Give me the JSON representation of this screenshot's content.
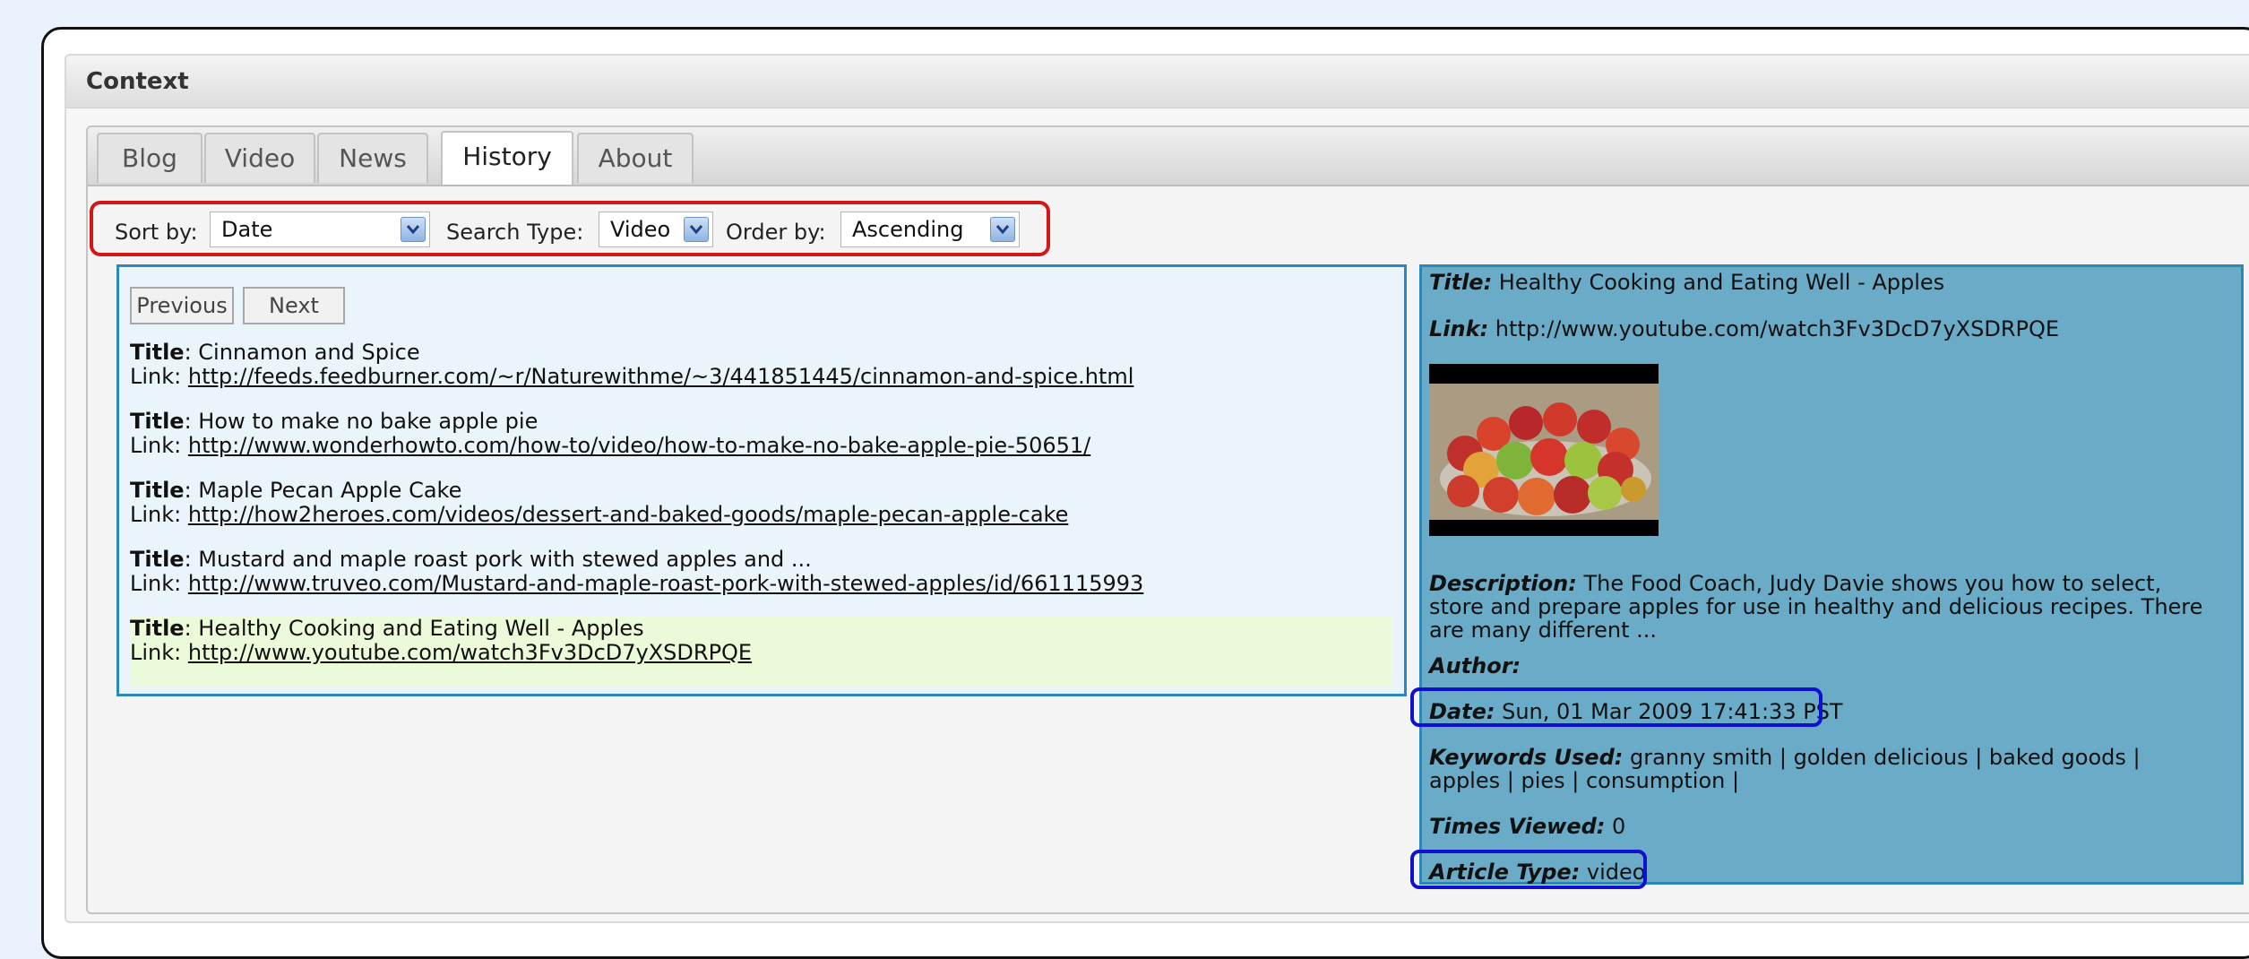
{
  "context": {
    "title": "Context"
  },
  "tabs": [
    {
      "label": "Blog"
    },
    {
      "label": "Video"
    },
    {
      "label": "News"
    },
    {
      "label": "History"
    },
    {
      "label": "About"
    }
  ],
  "controls": {
    "sort_by_label": "Sort by:",
    "sort_by_value": "Date",
    "search_type_label": "Search Type:",
    "search_type_value": "Video",
    "order_by_label": "Order by:",
    "order_by_value": "Ascending"
  },
  "pager": {
    "previous": "Previous",
    "next": "Next"
  },
  "results": [
    {
      "title_label": "Title",
      "title": ": Cinnamon and Spice",
      "link_label": "Link: ",
      "link": "http://feeds.feedburner.com/~r/Naturewithme/~3/441851445/cinnamon-and-spice.html"
    },
    {
      "title_label": "Title",
      "title": ": How to make no bake apple pie",
      "link_label": "Link: ",
      "link": "http://www.wonderhowto.com/how-to/video/how-to-make-no-bake-apple-pie-50651/"
    },
    {
      "title_label": "Title",
      "title": ": Maple Pecan Apple Cake",
      "link_label": "Link: ",
      "link": "http://how2heroes.com/videos/dessert-and-baked-goods/maple-pecan-apple-cake"
    },
    {
      "title_label": "Title",
      "title": ": Mustard and maple roast pork with stewed apples and ...",
      "link_label": "Link: ",
      "link": "http://www.truveo.com/Mustard-and-maple-roast-pork-with-stewed-apples/id/661115993"
    },
    {
      "title_label": "Title",
      "title": ": Healthy Cooking and Eating Well - Apples",
      "link_label": "Link: ",
      "link": "http://www.youtube.com/watch3Fv3DcD7yXSDRPQE"
    }
  ],
  "detail": {
    "title_label": "Title:",
    "title": " Healthy Cooking and Eating Well - Apples",
    "link_label": "Link:",
    "link": " http://www.youtube.com/watch3Fv3DcD7yXSDRPQE",
    "description_label": "Description:",
    "description": " The Food Coach, Judy Davie shows you how to select, store and prepare apples for use in healthy and delicious recipes. There are many different ...",
    "author_label": "Author:",
    "date_label": "Date:",
    "date": " Sun, 01 Mar 2009 17:41:33 PST",
    "keywords_label": "Keywords Used:",
    "keywords": " granny smith | golden delicious | baked goods | apples | pies | consumption |",
    "times_viewed_label": "Times Viewed:",
    "times_viewed": " 0",
    "article_type_label": "Article Type:",
    "article_type": " video"
  },
  "colors": {
    "controls_highlight": "#d01818",
    "field_highlight": "#1010d0",
    "detail_bg": "#6aabc8",
    "list_bg": "#eaf4fb",
    "selected_row_bg": "#ebfad9"
  }
}
